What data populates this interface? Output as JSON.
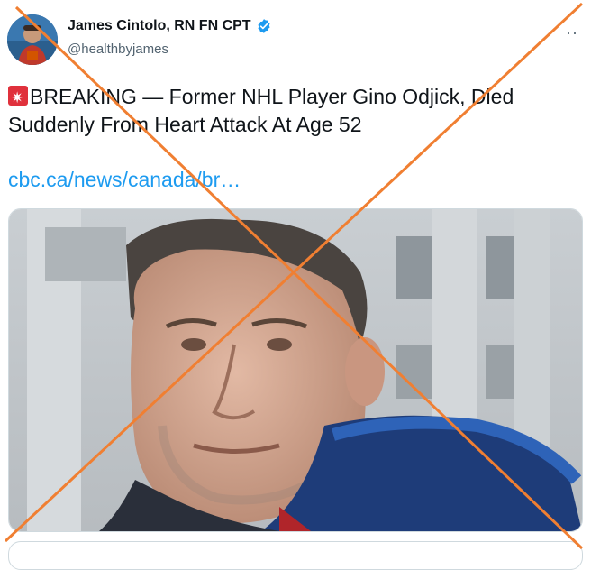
{
  "author": {
    "display_name": "James Cintolo, RN FN CPT",
    "handle": "@healthbyjames",
    "verified": true
  },
  "tweet": {
    "text": "BREAKING — Former NHL Player Gino Odjick, Died Suddenly From Heart Attack At Age 52",
    "emoji": "rotating-light-icon",
    "link_text": "cbc.ca/news/canada/br…"
  },
  "menu": {
    "more_label": "··"
  },
  "colors": {
    "link": "#1d9bf0",
    "verified": "#1d9bf0",
    "cross_overlay": "#f07f32"
  }
}
